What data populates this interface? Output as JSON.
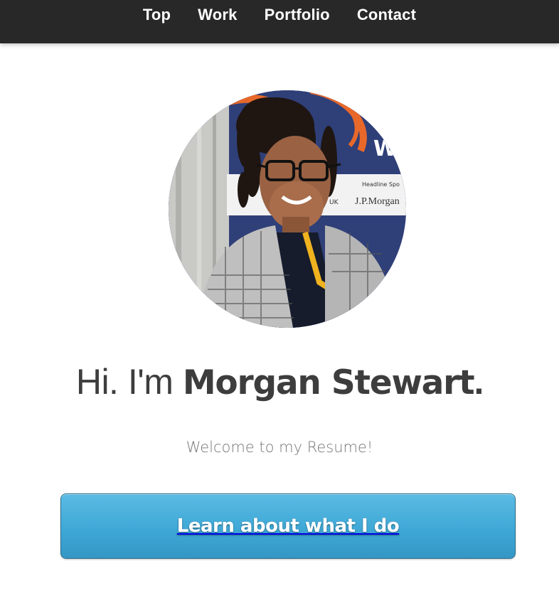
{
  "nav": {
    "items": [
      {
        "label": "Top"
      },
      {
        "label": "Work"
      },
      {
        "label": "Portfolio"
      },
      {
        "label": "Contact"
      }
    ],
    "background": "#282828"
  },
  "hero": {
    "photo_icon": "profile-photo",
    "greeting_prefix": "Hi. I'm ",
    "name": "Morgan Stewart",
    "greeting_suffix": ".",
    "subtitle": "Welcome to my Resume!",
    "cta_label": "Learn about what I do",
    "cta_color": "#43aad8"
  },
  "photo_sign": {
    "headline_text": "Headline Spo",
    "sponsor_text": "J.P.Morgan",
    "fragment_text": "UK",
    "letter_text": "W"
  }
}
